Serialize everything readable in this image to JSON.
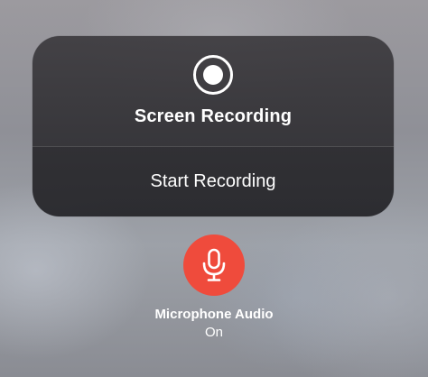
{
  "panel": {
    "title": "Screen Recording",
    "record_icon": "record-icon",
    "start_button_label": "Start Recording"
  },
  "microphone": {
    "icon": "microphone-icon",
    "label": "Microphone Audio",
    "status": "On",
    "accent_color": "#ef4b3c"
  }
}
